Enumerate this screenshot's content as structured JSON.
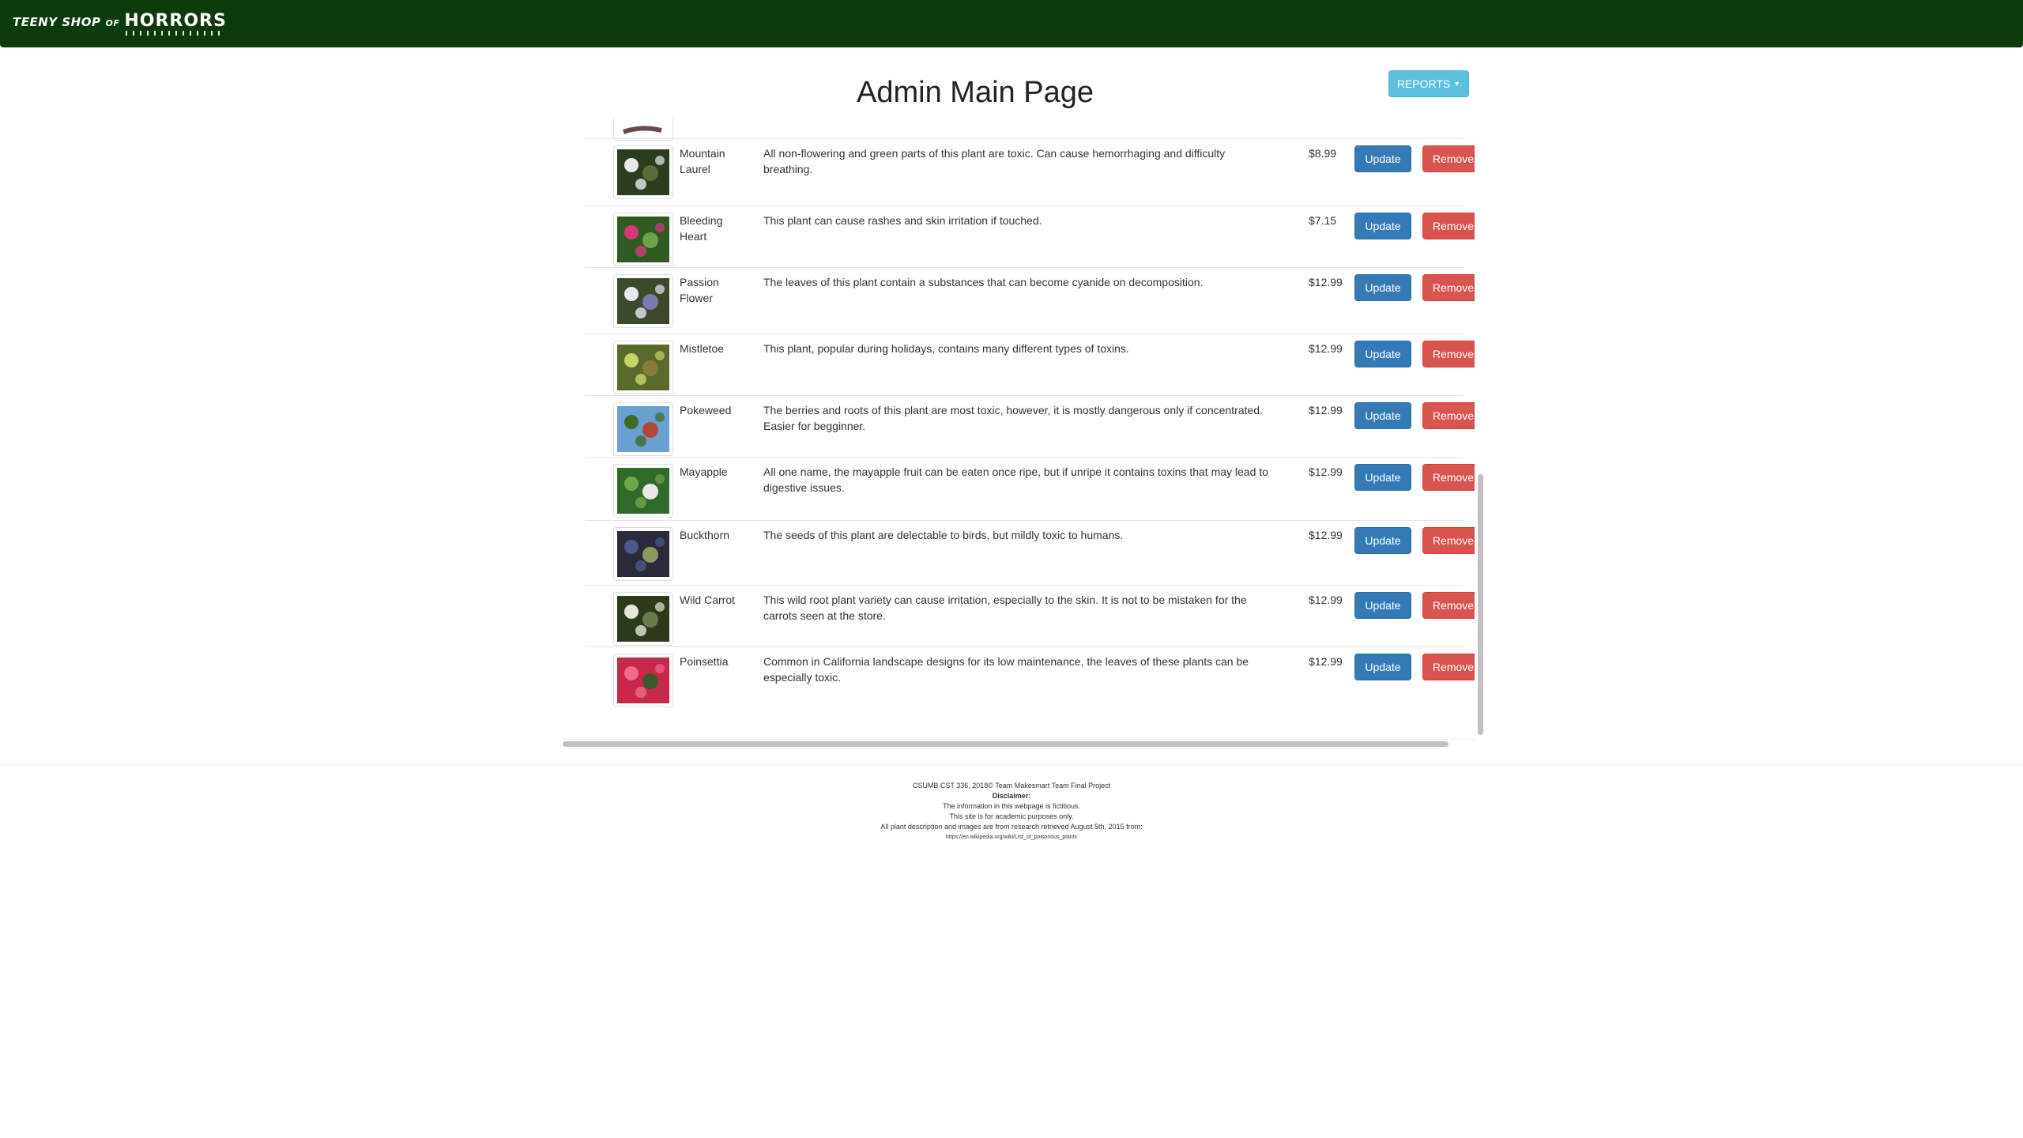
{
  "header": {
    "brand_part1": "TEENY SHOP",
    "brand_part2": "OF",
    "brand_part3": "HORRORS",
    "bg_color": "#0b3b0b"
  },
  "page": {
    "title": "Admin Main Page"
  },
  "reports": {
    "label": "REPORTS",
    "caret_icon": "caret-down-icon"
  },
  "actions": {
    "update_label": "Update",
    "remove_label": "Remove",
    "update_color": "#337ab7",
    "remove_color": "#d9534f"
  },
  "products": [
    {
      "name": "Mountain Laurel",
      "description": "All non-flowering and green parts of this plant are toxic. Can cause hemorrhaging and difficulty breathing.",
      "price": "$8.99"
    },
    {
      "name": "Bleeding Heart",
      "description": "This plant can cause rashes and skin irritation if touched.",
      "price": "$7.15"
    },
    {
      "name": "Passion Flower",
      "description": "The leaves of this plant contain a substances that can become cyanide on decomposition.",
      "price": "$12.99"
    },
    {
      "name": "Mistletoe",
      "description": "This plant, popular during holidays, contains many different types of toxins.",
      "price": "$12.99"
    },
    {
      "name": "Pokeweed",
      "description": "The berries and roots of this plant are most toxic, however, it is mostly dangerous only if concentrated. Easier for begginner.",
      "price": "$12.99"
    },
    {
      "name": "Mayapple",
      "description": "All one name, the mayapple fruit can be eaten once ripe, but if unripe it contains toxins that may lead to digestive issues.",
      "price": "$12.99"
    },
    {
      "name": "Buckthorn",
      "description": "The seeds of this plant are delectable to birds, but mildly toxic to humans.",
      "price": "$12.99"
    },
    {
      "name": "Wild Carrot",
      "description": "This wild root plant variety can cause irritation, especially to the skin. It is not to be mistaken for the carrots seen at the store.",
      "price": "$12.99"
    },
    {
      "name": "Poinsettia",
      "description": "Common in California landscape designs for its low maintenance, the leaves of these plants can be especially toxic.",
      "price": "$12.99"
    }
  ],
  "footer": {
    "line1": "CSUMB CST 336. 2018© Team Makesmart Team Final Project",
    "line2": "Disclaimer:",
    "line3": "The information in this webpage is fictitious.",
    "line4": "This site is for academic purposes only.",
    "line5": "All plant description and images are from research retrieved August 5th, 2015 from:",
    "line6": "https://en.wikipedia.org/wiki/List_of_poisonous_plants"
  }
}
